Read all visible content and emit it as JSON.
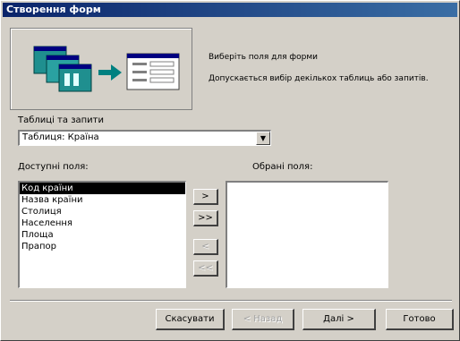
{
  "window": {
    "title": "Створення форм"
  },
  "instructions": {
    "line1": "Виберіть поля для форми",
    "line2": "Допускається вибір декількох таблиць або запитів."
  },
  "source": {
    "label": "Таблиці та запити",
    "value": "Таблиця: Країна"
  },
  "available": {
    "label": "Доступні поля:",
    "items": [
      "Код країни",
      "Назва країни",
      "Столиця",
      "Населення",
      "Площа",
      "Прапор"
    ],
    "selected_index": 0
  },
  "chosen": {
    "label": "Обрані поля:",
    "items": []
  },
  "move_buttons": {
    "add_one": ">",
    "add_all": ">>",
    "remove_one": "<",
    "remove_all": "<<"
  },
  "footer": {
    "cancel": "Скасувати",
    "back": "< Назад",
    "next": "Далі >",
    "finish": "Готово"
  },
  "colors": {
    "titlebar_start": "#0a246a",
    "titlebar_end": "#3a6ea5",
    "dialog": "#d4d0c8"
  }
}
